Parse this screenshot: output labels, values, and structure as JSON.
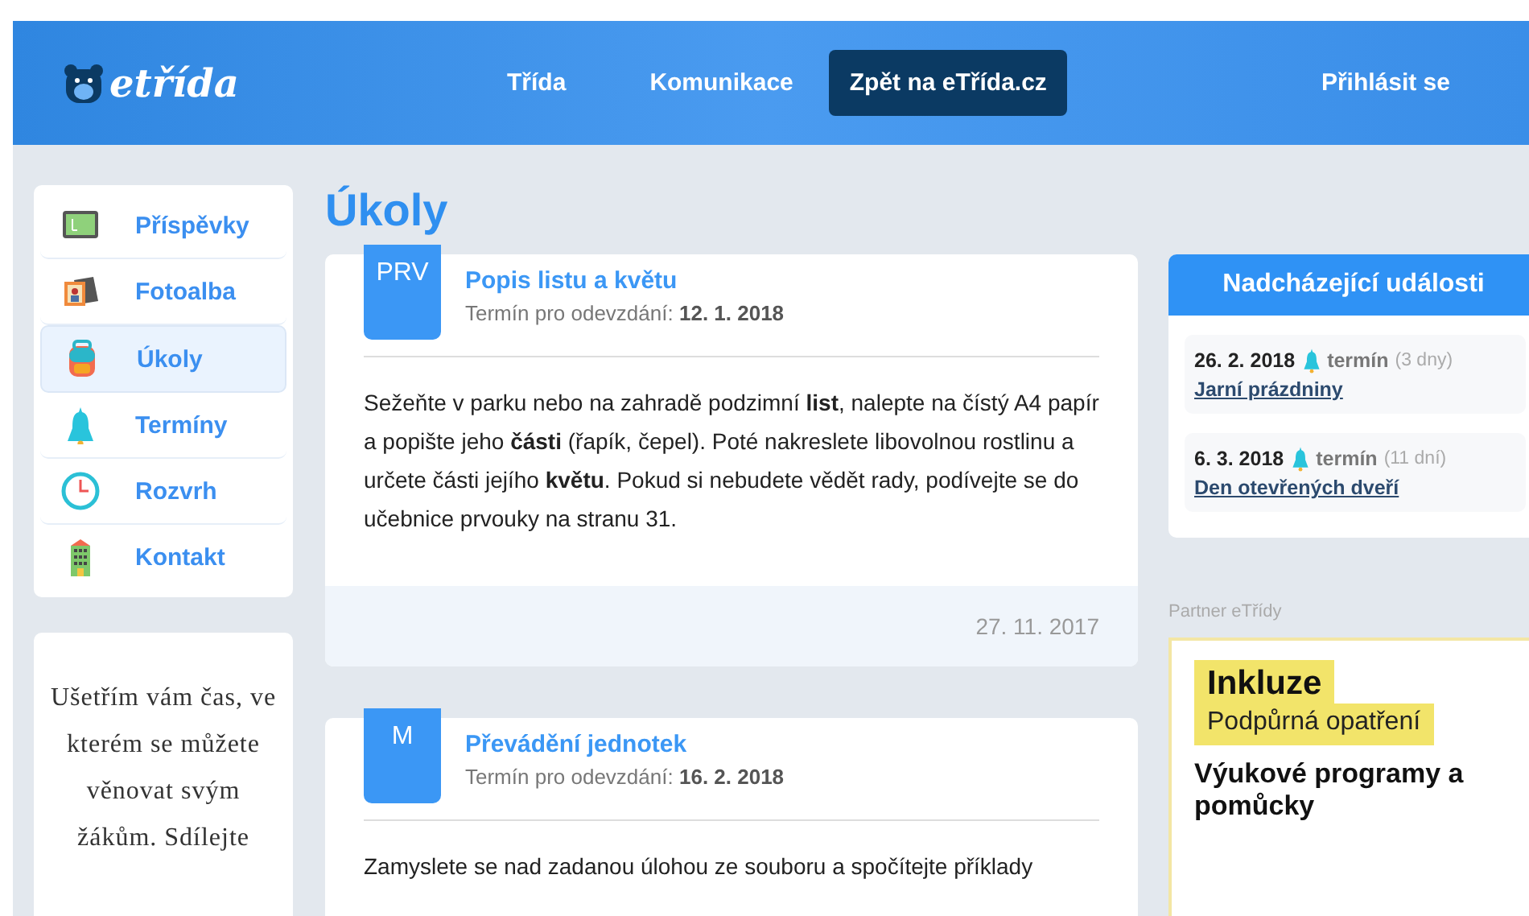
{
  "header": {
    "logo": "etřída",
    "nav": [
      {
        "label": "Třída",
        "kind": "link"
      },
      {
        "label": "Komunikace",
        "kind": "link"
      },
      {
        "label": "Zpět na eTřída.cz",
        "kind": "button"
      }
    ],
    "login": "Přihlásit se"
  },
  "sidebar": {
    "items": [
      {
        "label": "Příspěvky",
        "selected": false
      },
      {
        "label": "Fotoalba",
        "selected": false
      },
      {
        "label": "Úkoly",
        "selected": true
      },
      {
        "label": "Termíny",
        "selected": false
      },
      {
        "label": "Rozvrh",
        "selected": false
      },
      {
        "label": "Kontakt",
        "selected": false
      }
    ],
    "promo": "Ušetřím vám čas, ve kterém se můžete věnovat svým žákům. Sdílejte"
  },
  "page_title": "Úkoly",
  "tasks": [
    {
      "subject": "PRV",
      "title": "Popis listu a květu",
      "due_label": "Termín pro odevzdání:",
      "due": "12. 1. 2018",
      "body": "Sežeňte v parku nebo na zahradě podzimní **list**, nalepte na čístý A4 papír a popište jeho **části** (řapík, čepel). Poté nakreslete libovolnou rostlinu a určete části jejího **květu**. Pokud si nebudete vědět rady, podívejte se do učebnice prvouky na stranu 31.",
      "created": "27. 11. 2017"
    },
    {
      "subject": "M",
      "title": "Převádění jednotek",
      "due_label": "Termín pro odevzdání:",
      "due": "16. 2. 2018",
      "body": "Zamyslete se nad zadanou úlohou ze souboru a spočítejte příklady"
    }
  ],
  "events": {
    "title": "Nadcházející události",
    "items": [
      {
        "date": "26. 2. 2018",
        "type": "termín",
        "remaining": "(3 dny)",
        "name": "Jarní prázdniny"
      },
      {
        "date": "6. 3. 2018",
        "type": "termín",
        "remaining": "(11 dní)",
        "name": "Den otevřených dveří"
      }
    ]
  },
  "partner": {
    "label": "Partner eTřídy",
    "headline": "Inkluze",
    "subtitle": "Podpůrná opatření",
    "text": "Výukové programy a pomůcky"
  }
}
